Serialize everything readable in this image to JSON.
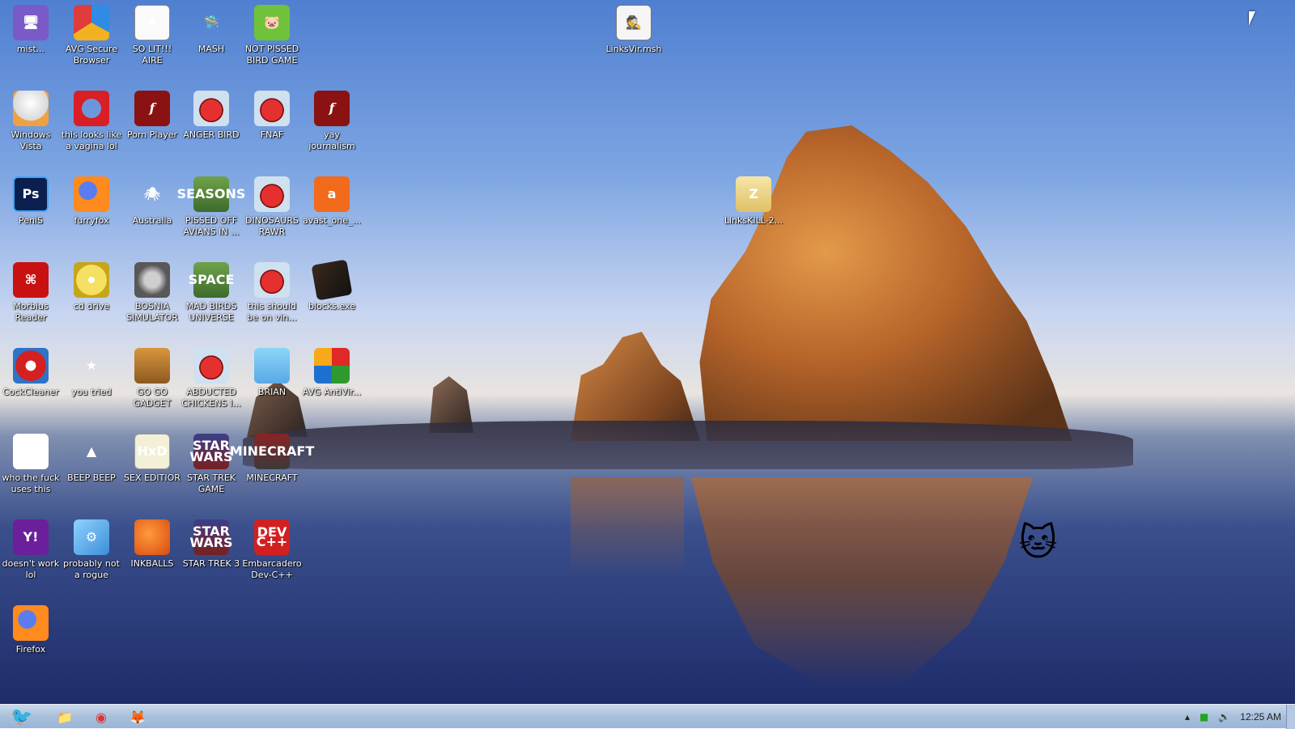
{
  "desktop": {
    "icons": [
      {
        "label": "mist...",
        "glyph": "🖥",
        "style": "purple"
      },
      {
        "label": "AVG Secure Browser",
        "glyph": "",
        "style": "avgbrowser"
      },
      {
        "label": "SO LIT!!! AIRE",
        "glyph": "♠",
        "style": "card"
      },
      {
        "label": "MASH",
        "glyph": "🛸",
        "style": "ufo"
      },
      {
        "label": "NOT PISSED BIRD GAME",
        "glyph": "🐷",
        "style": "pig"
      },
      {
        "label": "Windows Vista",
        "glyph": "",
        "style": "egg"
      },
      {
        "label": "this looks like a vagina lol",
        "glyph": "",
        "style": "opera"
      },
      {
        "label": "Porn Player",
        "glyph": "f",
        "style": "flash"
      },
      {
        "label": "ANGER BIRD",
        "glyph": "",
        "style": "ang"
      },
      {
        "label": "FNAF",
        "glyph": "",
        "style": "ang"
      },
      {
        "label": "yay journalism",
        "glyph": "f",
        "style": "flash"
      },
      {
        "label": "PeniS",
        "glyph": "Ps",
        "style": "ps"
      },
      {
        "label": "furryfox",
        "glyph": "",
        "style": "ff"
      },
      {
        "label": "Australia",
        "glyph": "🕷",
        "style": "spider"
      },
      {
        "label": "PISSED OFF AVIANS IN ...",
        "glyph": "SEASONS",
        "style": "seasons"
      },
      {
        "label": "DINOSAURS RAWR",
        "glyph": "",
        "style": "ang"
      },
      {
        "label": "avast_one_...",
        "glyph": "a",
        "style": "avast"
      },
      {
        "label": "Morbius Reader",
        "glyph": "⌘",
        "style": "pdf"
      },
      {
        "label": "cd drive",
        "glyph": "",
        "style": "cd"
      },
      {
        "label": "BOSNIA SIMULATOR",
        "glyph": "",
        "style": "mine"
      },
      {
        "label": "MAD BIRDS UNIVERSE",
        "glyph": "SPACE",
        "style": "seasons"
      },
      {
        "label": "this should be on vin...",
        "glyph": "",
        "style": "ang"
      },
      {
        "label": "blocks.exe",
        "glyph": "",
        "style": "board"
      },
      {
        "label": "CockCleaner",
        "glyph": "",
        "style": "ccleaner"
      },
      {
        "label": "you tried",
        "glyph": "★",
        "style": "star"
      },
      {
        "label": "GO GO GADGET",
        "glyph": "",
        "style": "briefcase"
      },
      {
        "label": "ABDUCTED CHICKENS I...",
        "glyph": "",
        "style": "ang"
      },
      {
        "label": "BRIAN",
        "glyph": "",
        "style": "brian"
      },
      {
        "label": "AVG AntiVir...",
        "glyph": "",
        "style": "avg"
      },
      {
        "label": "who the fuck uses this",
        "glyph": "⚡",
        "style": "bolt"
      },
      {
        "label": "BEEP BEEP",
        "glyph": "▲",
        "style": "cone"
      },
      {
        "label": "SEX EDITIOR",
        "glyph": "HxD",
        "style": "hxd"
      },
      {
        "label": "STAR TREK GAME",
        "glyph": "STAR WARS",
        "style": "sw"
      },
      {
        "label": "MINECRAFT",
        "glyph": "MINECRAFT",
        "style": "mc"
      },
      {
        "label": "doesn't work lol",
        "glyph": "Y!",
        "style": "yahoo"
      },
      {
        "label": "probably not a rogue",
        "glyph": "⚙",
        "style": "gears"
      },
      {
        "label": "INKBALLS",
        "glyph": "",
        "style": "ink"
      },
      {
        "label": "STAR TREK 3",
        "glyph": "STAR WARS",
        "style": "sw"
      },
      {
        "label": "Embarcadero Dev-C++",
        "glyph": "DEV C++",
        "style": "dev"
      },
      {
        "label": "Firefox",
        "glyph": "",
        "style": "ff"
      },
      {
        "label": "LinksVir.msh",
        "glyph": "🕵",
        "style": "agent"
      },
      {
        "label": "LinksKILL-2...",
        "glyph": "Z",
        "style": "folderz"
      }
    ]
  },
  "taskbar": {
    "start_glyph": "🐦",
    "pinned": [
      {
        "name": "file-explorer",
        "glyph": "📁"
      },
      {
        "name": "chrome",
        "glyph": "◉"
      },
      {
        "name": "firefox",
        "glyph": "🦊"
      }
    ],
    "tray": {
      "chevron": "▴",
      "network": "■",
      "volume": "🔊",
      "clock": "12:25 AM"
    }
  },
  "colors": {
    "taskbar": "#a9c0dd",
    "sky_top": "#4f7fd0",
    "rock": "#b8652a",
    "sea": "#1e2c6a"
  }
}
